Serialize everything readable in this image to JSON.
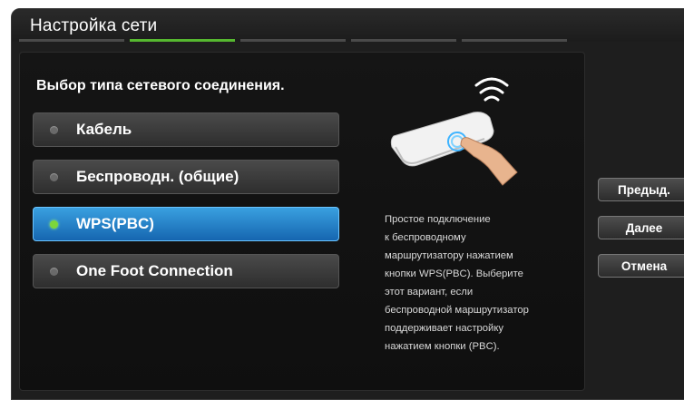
{
  "window": {
    "title": "Настройка сети"
  },
  "wizard": {
    "steps_total": 5,
    "current_step": 2
  },
  "content": {
    "prompt": "Выбор типа сетевого соединения.",
    "options": [
      {
        "label": "Кабель",
        "selected": false
      },
      {
        "label": "Беспроводн. (общие)",
        "selected": false
      },
      {
        "label": "WPS(PBC)",
        "selected": true
      },
      {
        "label": "One Foot Connection",
        "selected": false
      }
    ],
    "description_lines": [
      "Простое подключение",
      "к беспроводному",
      "маршрутизатору нажатием",
      "кнопки WPS(PBC). Выберите",
      "этот вариант, если",
      "беспроводной маршрутизатор",
      "поддерживает настройку",
      "нажатием кнопки (PBC)."
    ],
    "illustration_icon": "wps-router-hand-icon"
  },
  "nav": {
    "prev_label": "Предыд.",
    "next_label": "Далее",
    "cancel_label": "Отмена"
  },
  "colors": {
    "selected_option": "#1f7fd0",
    "progress_active": "#56b830",
    "background": "#1e1e1e"
  }
}
